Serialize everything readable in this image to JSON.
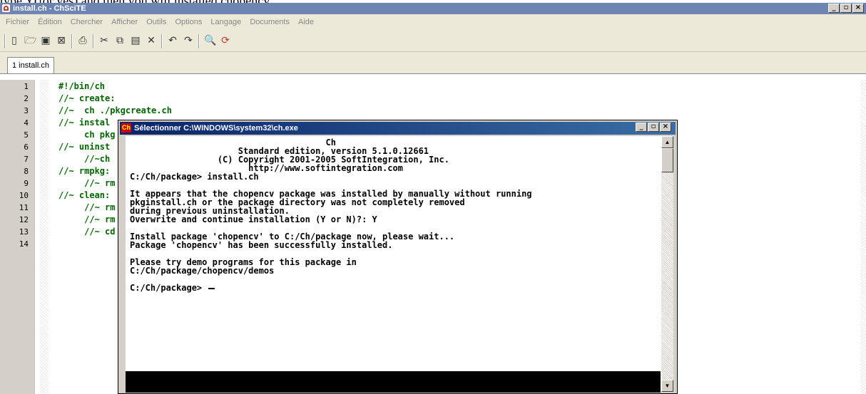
{
  "top_fragment": "type Y(for yes) and then you will installed chopencv",
  "window": {
    "title": "install.ch - ChSciTE",
    "min_label": "_",
    "restore_label": "▫",
    "close_label": "×"
  },
  "menu": [
    "Fichier",
    "Édition",
    "Chercher",
    "Afficher",
    "Outils",
    "Options",
    "Langage",
    "Documents",
    "Aide"
  ],
  "toolbar_icons": [
    "new-file-icon",
    "open-folder-icon",
    "save-icon",
    "close-file-icon",
    "print-icon",
    "cut-icon",
    "copy-icon",
    "paste-icon",
    "delete-icon",
    "undo-icon",
    "redo-icon",
    "find-icon",
    "replace-icon"
  ],
  "tab": {
    "label": "1 install.ch"
  },
  "editor": {
    "line_numbers": [
      "1",
      "2",
      "3",
      "4",
      "5",
      "6",
      "7",
      "8",
      "9",
      "10",
      "11",
      "12",
      "13",
      "14"
    ],
    "lines": [
      "#!/bin/ch",
      "//~ create:",
      "//~  ch ./pkgcreate.ch",
      "//~ instal",
      "     ch pkg",
      "//~ uninst",
      "     //~ch",
      "//~ rmpkg:",
      "     //~ rm",
      "//~ clean:",
      "     //~ rm",
      "     //~ rm",
      "     //~ cd",
      ""
    ]
  },
  "console": {
    "title": "Sélectionner C:\\WINDOWS\\system32\\ch.exe",
    "icon_label": "Ch",
    "lines": [
      "                                      Ch",
      "                     Standard edition, version 5.1.0.12661",
      "                 (C) Copyright 2001-2005 SoftIntegration, Inc.",
      "                       http://www.softintegration.com",
      "C:/Ch/package> install.ch",
      "",
      "It appears that the chopencv package was installed by manually without running",
      "pkginstall.ch or the package directory was not completely removed",
      "during previous uninstallation.",
      "Overwrite and continue installation (Y or N)?: Y",
      "",
      "Install package 'chopencv' to C:/Ch/package now, please wait...",
      "Package 'chopencv' has been successfully installed.",
      "",
      "Please try demo programs for this package in",
      "C:/Ch/package/chopencv/demos",
      "",
      "C:/Ch/package> "
    ],
    "scroll_up": "▲",
    "scroll_down": "▼"
  }
}
